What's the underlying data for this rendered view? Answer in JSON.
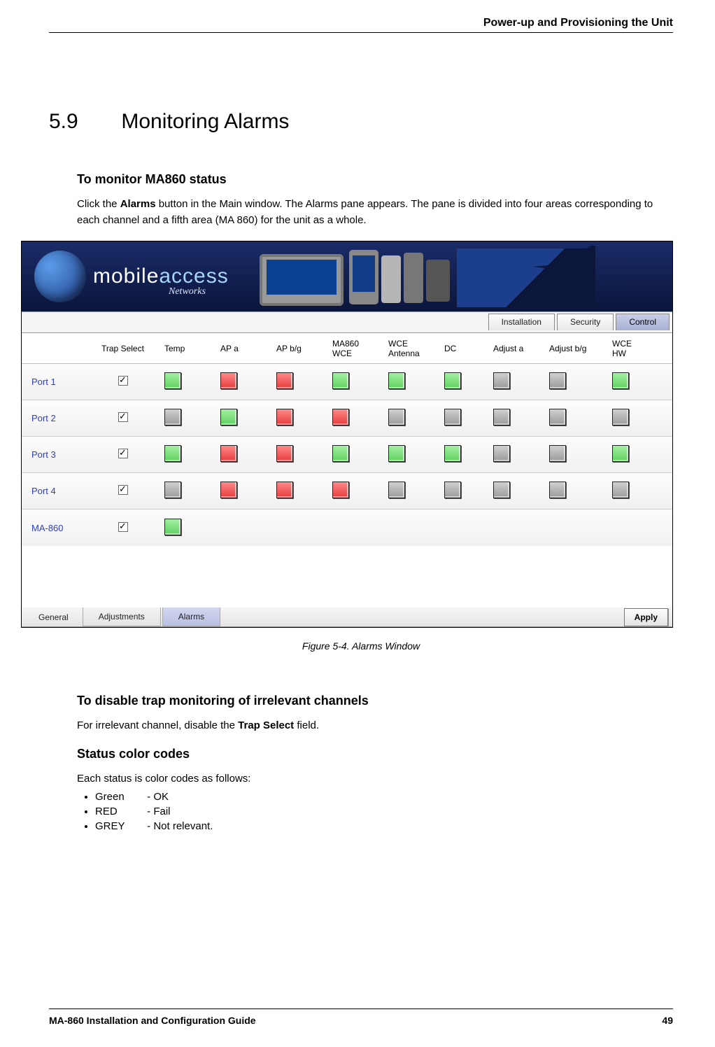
{
  "header": {
    "running_head": "Power-up and Provisioning the Unit"
  },
  "section": {
    "number": "5.9",
    "title": "Monitoring Alarms"
  },
  "monitor": {
    "subheading": "To monitor MA860 status",
    "para_prefix": "Click the ",
    "para_bold": "Alarms",
    "para_suffix": " button in the Main window. The Alarms pane appears. The pane is divided into four areas corresponding to each channel and a fifth area (MA 860) for the unit as a whole."
  },
  "banner": {
    "brand_strong": "mobile",
    "brand_thin": "access",
    "subtitle": "Networks"
  },
  "tabs_top": {
    "installation": "Installation",
    "security": "Security",
    "control": "Control"
  },
  "columns": {
    "blank": "",
    "trap_select": "Trap Select",
    "temp": "Temp",
    "ap_a": "AP a",
    "ap_bg": "AP b/g",
    "ma860_wce": "MA860\nWCE",
    "wce_ant": "WCE\nAntenna",
    "dc": "DC",
    "adjust_a": "Adjust a",
    "adjust_bg": "Adjust b/g",
    "wce_hw": "WCE\nHW"
  },
  "rows": {
    "0": {
      "label": "Port 1",
      "cells": {
        "temp": "green",
        "ap_a": "red",
        "ap_bg": "red",
        "ma860_wce": "green",
        "wce_ant": "green",
        "dc": "green",
        "adjust_a": "grey",
        "adjust_bg": "grey",
        "wce_hw": "green"
      }
    },
    "1": {
      "label": "Port 2",
      "cells": {
        "temp": "grey",
        "ap_a": "green",
        "ap_bg": "red",
        "ma860_wce": "red",
        "wce_ant": "grey",
        "dc": "grey",
        "adjust_a": "grey",
        "adjust_bg": "grey",
        "wce_hw": "grey"
      }
    },
    "2": {
      "label": "Port 3",
      "cells": {
        "temp": "green",
        "ap_a": "red",
        "ap_bg": "red",
        "ma860_wce": "green",
        "wce_ant": "green",
        "dc": "green",
        "adjust_a": "grey",
        "adjust_bg": "grey",
        "wce_hw": "green"
      }
    },
    "3": {
      "label": "Port 4",
      "cells": {
        "temp": "grey",
        "ap_a": "red",
        "ap_bg": "red",
        "ma860_wce": "red",
        "wce_ant": "grey",
        "dc": "grey",
        "adjust_a": "grey",
        "adjust_bg": "grey",
        "wce_hw": "grey"
      }
    },
    "4": {
      "label": "MA-860",
      "cells": {
        "temp": "green"
      }
    }
  },
  "tabs_bottom": {
    "general": "General",
    "adjustments": "Adjustments",
    "alarms": "Alarms",
    "apply": "Apply"
  },
  "figure_caption": "Figure 5-4. Alarms Window",
  "disable_trap": {
    "subheading": "To disable trap monitoring of irrelevant channels",
    "para_prefix": "For irrelevant channel, disable the ",
    "para_bold": "Trap Select",
    "para_suffix": " field."
  },
  "status_codes": {
    "subheading": "Status color codes",
    "intro": "Each status is color codes as follows:",
    "items": {
      "0": {
        "code": "Green",
        "desc": "- OK"
      },
      "1": {
        "code": "RED",
        "desc": "- Fail"
      },
      "2": {
        "code": "GREY",
        "desc": "- Not relevant."
      }
    }
  },
  "footer": {
    "guide": "MA-860 Installation and Configuration Guide",
    "page": "49"
  }
}
